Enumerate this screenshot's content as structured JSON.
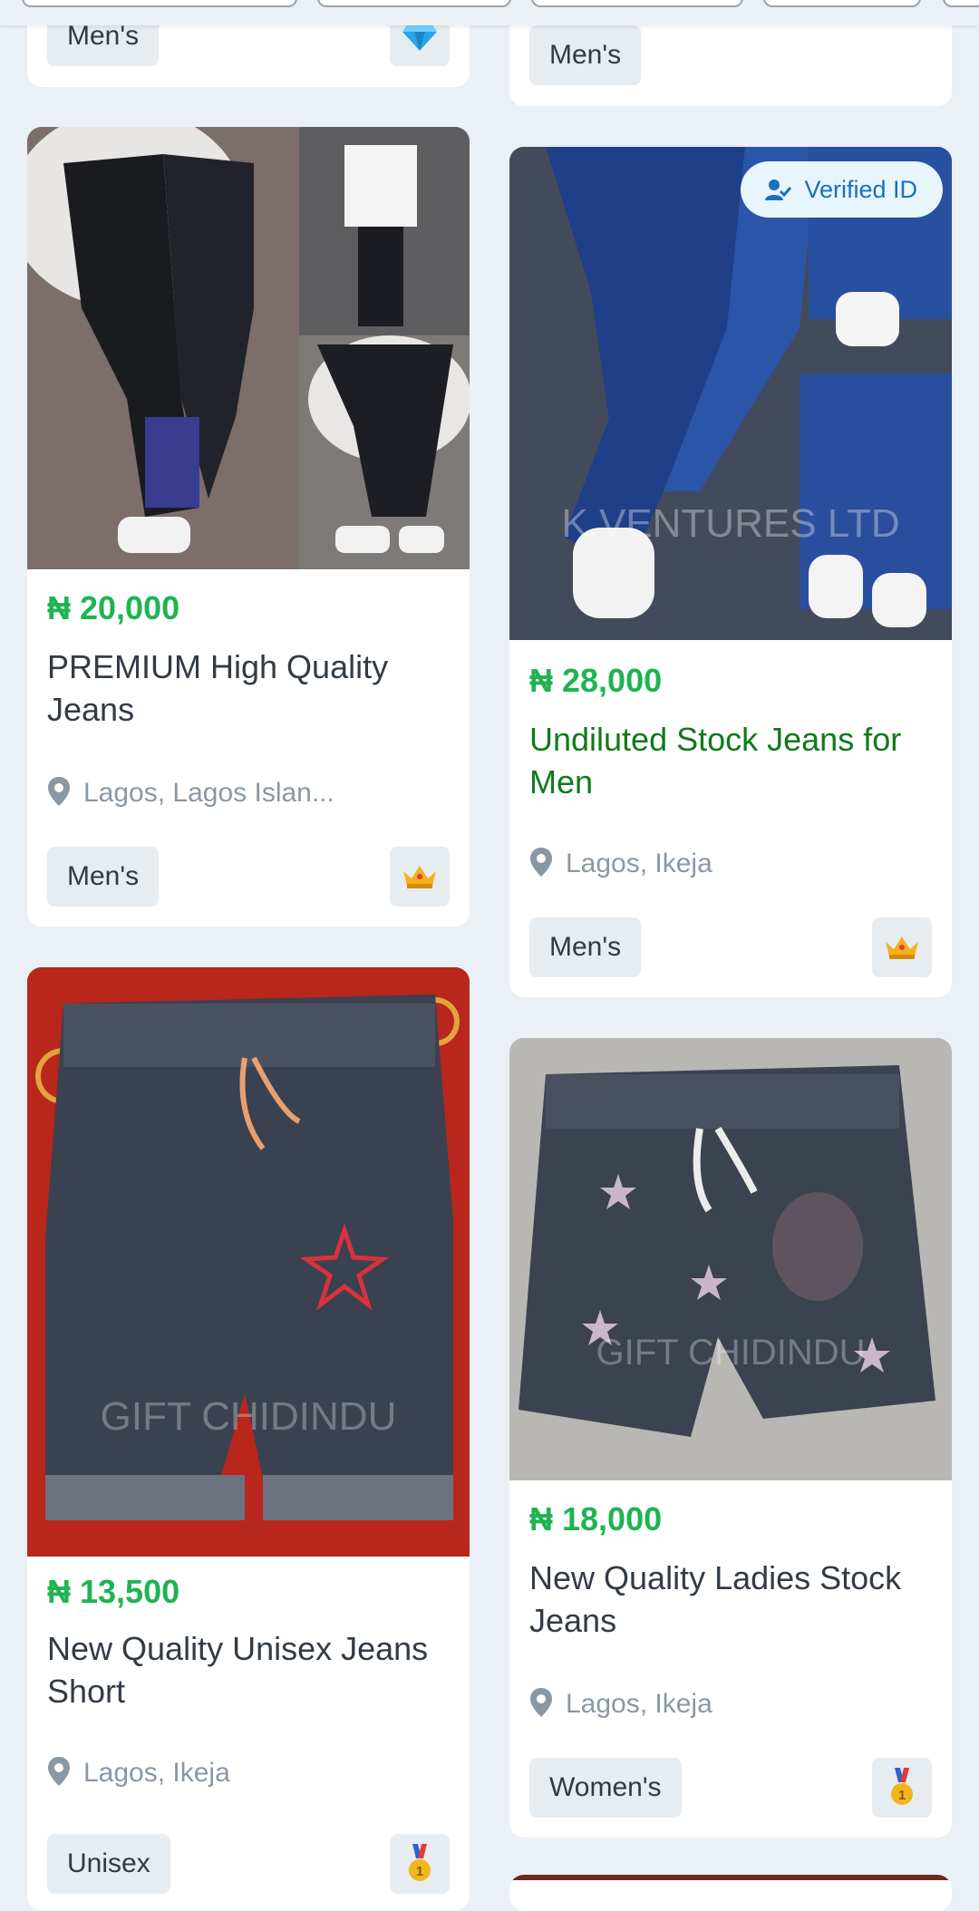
{
  "top_tags": {
    "left": "Men's",
    "right": "Men's"
  },
  "listings": [
    {
      "price": "₦ 20,000",
      "title": "PREMIUM High Quality Jeans",
      "location": "Lagos, Lagos Islan...",
      "category": "Men's",
      "badge_icon": "crown-icon",
      "image_desc": "black distressed jeans collage"
    },
    {
      "price": "₦ 28,000",
      "title": "Undiluted Stock Jeans for Men",
      "location": "Lagos, Ikeja",
      "category": "Men's",
      "badge_icon": "crown-icon",
      "verified_label": "Verified ID",
      "watermark": "K.VENTURES LTD",
      "image_desc": "blue jeans collage"
    },
    {
      "price": "₦ 13,500",
      "title": "New Quality Unisex Jeans Short",
      "location": "Lagos, Ikeja",
      "category": "Unisex",
      "badge_icon": "medal-icon",
      "watermark": "GIFT CHIDINDU",
      "image_desc": "dark denim shorts on red cloth"
    },
    {
      "price": "₦ 18,000",
      "title": "New Quality Ladies Stock Jeans",
      "location": "Lagos, Ikeja",
      "category": "Women's",
      "badge_icon": "medal-icon",
      "watermark": "GIFT CHIDINDU",
      "image_desc": "star print denim shorts"
    }
  ],
  "colors": {
    "price": "#1fb352",
    "visited_title": "#0f7a1a",
    "background": "#ebf0f6"
  }
}
